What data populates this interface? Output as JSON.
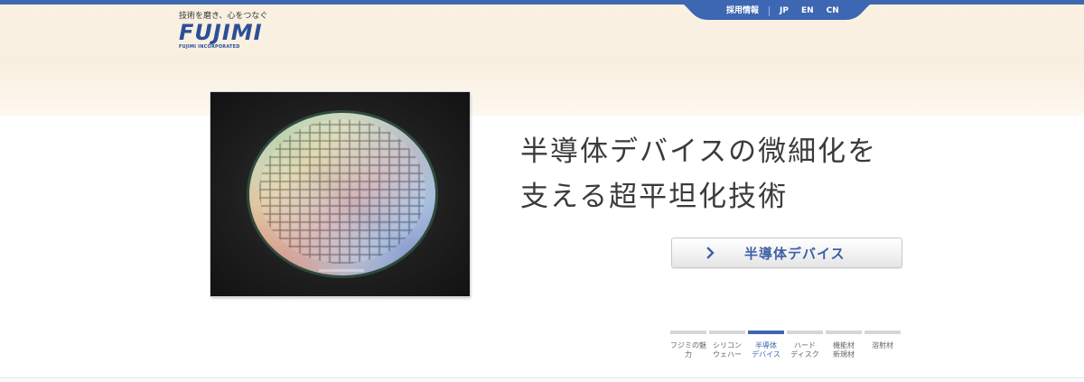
{
  "header": {
    "utility_links": [
      "採用情報",
      "JP",
      "EN",
      "CN"
    ],
    "colors": {
      "accent": "#3f67b0",
      "background": "#fbf1e2"
    }
  },
  "logo": {
    "tagline": "技術を磨き、心をつなぐ",
    "mark": "FUJIMI",
    "corporation": "FUJIMI INCORPORATED"
  },
  "hero": {
    "image_alt_icon": "silicon-wafer-photo",
    "headline_line1": "半導体デバイスの微細化を",
    "headline_line2": "支える超平坦化技術",
    "cta_icon": "chevron-right-icon",
    "cta_label": "半導体デバイス"
  },
  "slide_nav": {
    "items": [
      {
        "label": "フジミの魅力",
        "active": false
      },
      {
        "label": "シリコン\nウェハー",
        "active": false
      },
      {
        "label": "半導体\nデバイス",
        "active": true
      },
      {
        "label": "ハード\nディスク",
        "active": false
      },
      {
        "label": "機能材\n新規材",
        "active": false
      },
      {
        "label": "溶射材",
        "active": false
      }
    ]
  }
}
